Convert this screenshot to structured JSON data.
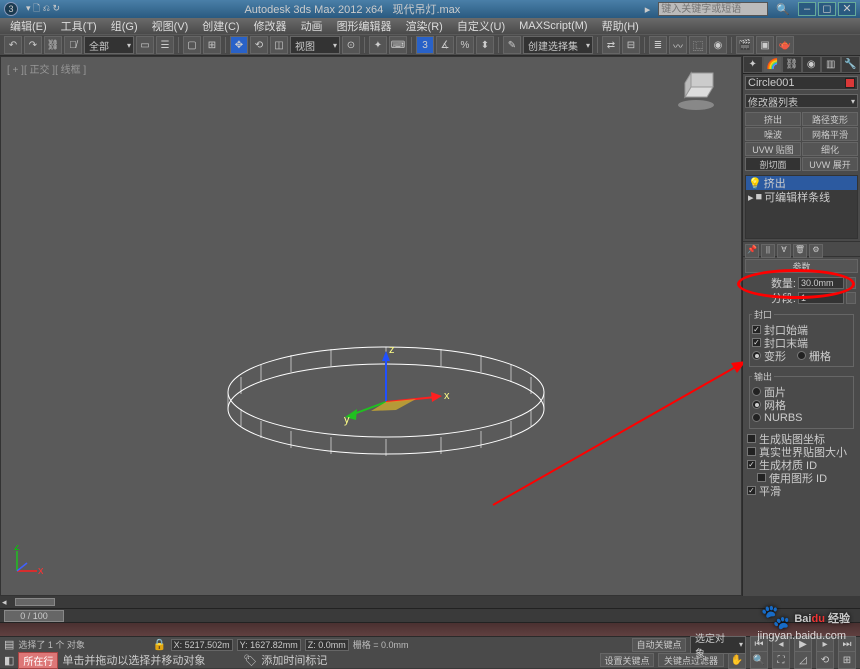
{
  "titlebar": {
    "app": "Autodesk 3ds Max 2012 x64",
    "file": "现代吊灯.max",
    "search_placeholder": "键入关键字或短语"
  },
  "menubar": [
    "编辑(E)",
    "工具(T)",
    "组(G)",
    "视图(V)",
    "创建(C)",
    "修改器",
    "动画",
    "图形编辑器",
    "渲染(R)",
    "自定义(U)",
    "MAXScript(M)",
    "帮助(H)"
  ],
  "toolbar": {
    "all_label": "全部",
    "view_label": "视图",
    "selset_label": "创建选择集"
  },
  "viewport": {
    "label": "[ + ][ 正交 ][ 线框 ]"
  },
  "cmdpanel": {
    "objname": "Circle001",
    "modlist_label": "修改器列表",
    "buttons": [
      "挤出",
      "路径变形",
      "噪波",
      "网格平滑",
      "UVW 贴图",
      "细化",
      "剖切面",
      "UVW 展开"
    ],
    "stack_sel": "挤出",
    "stack_item": "可编辑样条线",
    "rollout_params": "参数",
    "amount_label": "数量:",
    "amount_value": "30.0mm",
    "segments_label": "分段:",
    "segments_value": "1",
    "cap_group": "封口",
    "cap_start": "封口始端",
    "cap_end": "封口末端",
    "morph": "变形",
    "grid": "栅格",
    "output_group": "输出",
    "out_patch": "面片",
    "out_mesh": "网格",
    "out_nurbs": "NURBS",
    "gen_mapcoords": "生成贴图坐标",
    "realworld": "真实世界贴图大小",
    "gen_matids": "生成材质 ID",
    "use_shapeids": "使用图形 ID",
    "smooth": "平滑"
  },
  "timeslider": {
    "pos": "0 / 100"
  },
  "statusbar": {
    "selected": "选择了 1 个 对象",
    "x": "X: 5217.502m",
    "y": "Y: 1627.82mm",
    "z": "Z: 0.0mm",
    "grid": "栅格 = 0.0mm",
    "autokey": "自动关键点",
    "selfilter": "选定对象"
  },
  "promptbar": {
    "tag": "所在行",
    "hint": "单击并拖动以选择并移动对象",
    "addtime": "添加时间标记",
    "setkey": "设置关键点",
    "keyfilter": "关键点过滤器"
  },
  "watermark": {
    "brand": "Baidu 经验",
    "url": "jingyan.baidu.com"
  }
}
